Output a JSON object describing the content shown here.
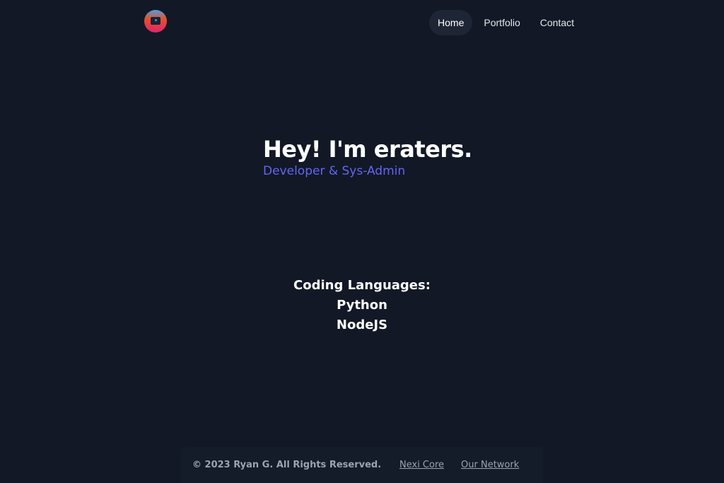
{
  "header": {
    "logo": "logo-icon",
    "nav": [
      {
        "label": "Home",
        "active": true
      },
      {
        "label": "Portfolio",
        "active": false
      },
      {
        "label": "Contact",
        "active": false
      }
    ]
  },
  "hero": {
    "title": "Hey! I'm eraters.",
    "subtitle": "Developer & Sys-Admin"
  },
  "languages": {
    "heading": "Coding Languages:",
    "items": [
      "Python",
      "NodeJS"
    ]
  },
  "footer": {
    "copyright": "© 2023 Ryan G. All Rights Reserved.",
    "links": [
      "Nexi Core",
      "Our Network"
    ]
  },
  "colors": {
    "background": "#121826",
    "accent": "#6366f1",
    "text": "#ffffff",
    "muted": "#9ca3af"
  }
}
